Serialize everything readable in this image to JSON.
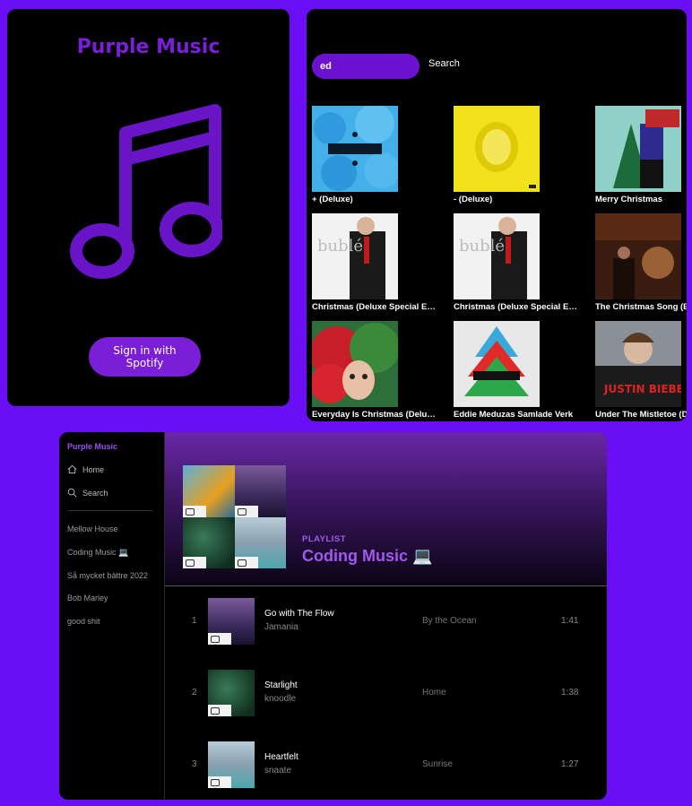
{
  "login": {
    "title": "Purple Music",
    "signin_label": "Sign in with Spotify",
    "accent": "#7a1ed8"
  },
  "search": {
    "query": "ed",
    "button_label": "Search",
    "albums": [
      {
        "title": "+ (Deluxe)"
      },
      {
        "title": "- (Deluxe)"
      },
      {
        "title": "Merry Christmas"
      },
      {
        "title": "Christmas (Deluxe Special Edition)"
      },
      {
        "title": "Christmas (Deluxe Special Edition)"
      },
      {
        "title": "The Christmas Song (Expanded Edition)"
      },
      {
        "title": "Everyday Is Christmas (Deluxe Edition)"
      },
      {
        "title": "Eddie Meduzas Samlade Verk"
      },
      {
        "title": "Under The Mistletoe (Deluxe Edition)"
      }
    ]
  },
  "player": {
    "brand": "Purple Music",
    "nav": {
      "home": "Home",
      "search": "Search"
    },
    "playlists": [
      "Mellow House",
      "Coding Music 💻",
      "Så mycket bättre 2022",
      "Bob Marley",
      "good shit"
    ],
    "playlist_type": "PLAYLIST",
    "playlist_title": "Coding Music 💻",
    "tracks": [
      {
        "num": "1",
        "name": "Go with The Flow",
        "artist": "Jamania",
        "album": "By the Ocean",
        "duration": "1:41"
      },
      {
        "num": "2",
        "name": "Starlight",
        "artist": "knoodle",
        "album": "Home",
        "duration": "1:38"
      },
      {
        "num": "3",
        "name": "Heartfelt",
        "artist": "snaate",
        "album": "Sunrise",
        "duration": "1:27"
      }
    ]
  }
}
